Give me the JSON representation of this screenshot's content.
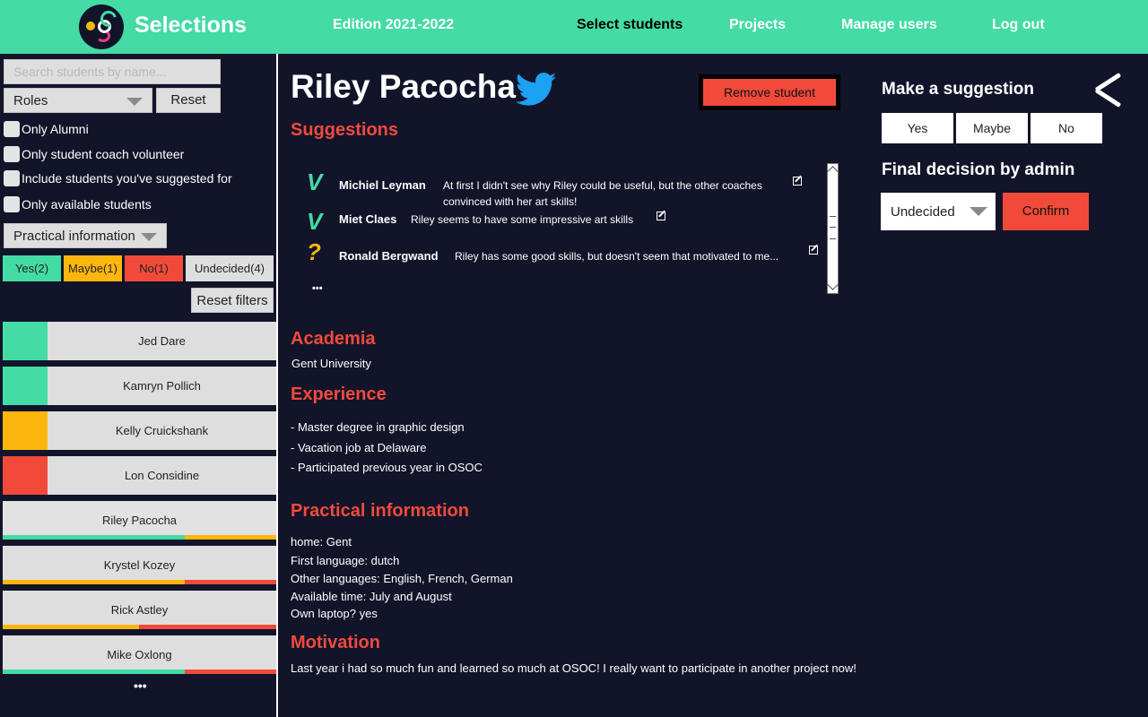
{
  "header": {
    "brand": "Selections",
    "edition": "Edition 2021-2022",
    "nav": [
      {
        "label": "Select students",
        "active": true
      },
      {
        "label": "Projects"
      },
      {
        "label": "Manage users"
      },
      {
        "label": "Log out"
      }
    ]
  },
  "sidebar": {
    "search_placeholder": "Search students by name...",
    "roles_label": "Roles",
    "reset_label": "Reset",
    "filters": [
      "Only Alumni",
      "Only student coach volunteer",
      "Include students you've suggested for",
      "Only available students"
    ],
    "practical_label": "Practical information",
    "status_buttons": [
      {
        "label": "Yes(2)",
        "color": "#44dba4"
      },
      {
        "label": "Maybe(1)",
        "color": "#fcb70f"
      },
      {
        "label": "No(1)",
        "color": "#f14a3b"
      },
      {
        "label": "Undecided(4)",
        "color": "#dedede"
      }
    ],
    "reset_filters_label": "Reset filters",
    "students": [
      {
        "name": "Jed Dare",
        "status_color": "#44dba4"
      },
      {
        "name": "Kamryn Pollich",
        "status_color": "#44dba4"
      },
      {
        "name": "Kelly Cruickshank",
        "status_color": "#fcb70f"
      },
      {
        "name": "Lon Considine",
        "status_color": "#f14a3b"
      },
      {
        "name": "Riley Pacocha",
        "bar_colors": [
          "#44dba4",
          "#44dba4",
          "#fcb70f"
        ]
      },
      {
        "name": "Krystel Kozey",
        "bar_colors": [
          "#fcb70f",
          "#fcb70f",
          "#f14a3b"
        ]
      },
      {
        "name": "Rick Astley",
        "bar_colors": [
          "#fcb70f",
          "#f14a3b"
        ]
      },
      {
        "name": "Mike Oxlong",
        "bar_colors": [
          "#44dba4",
          "#44dba4",
          "#f14a3b"
        ]
      }
    ],
    "more": "•••"
  },
  "student": {
    "name": "Riley Pacocha",
    "remove_label": "Remove student",
    "suggestions_title": "Suggestions",
    "suggestions": [
      {
        "icon": "V",
        "icon_color": "#44dba4",
        "coach": "Michiel Leyman",
        "text": "At first I didn't see why Riley could be useful, but the other coaches convinced with her art skills!"
      },
      {
        "icon": "V",
        "icon_color": "#44dba4",
        "coach": "Miet Claes",
        "text": "Riley seems to have some impressive art skills"
      },
      {
        "icon": "?",
        "icon_color": "#fcb70f",
        "coach": "Ronald Bergwand",
        "text": "Riley has some good skills, but doesn't seem that motivated to me..."
      }
    ],
    "suggestions_more": "•••",
    "academia_title": "Academia",
    "academia": "Gent University",
    "experience_title": "Experience",
    "experience": [
      "- Master degree in graphic design",
      "- Vacation job at Delaware",
      "- Participated previous year in OSOC"
    ],
    "practical_title": "Practical information",
    "practical": [
      "home: Gent",
      "First language: dutch",
      "Other languages: English, French, German",
      "Available time: July and August",
      "Own laptop? yes"
    ],
    "motivation_title": "Motivation",
    "motivation": "Last year i had so much fun and learned so much at OSOC! I really want to participate in another project now!"
  },
  "decision": {
    "suggestion_title": "Make a suggestion",
    "buttons": [
      "Yes",
      "Maybe",
      "No"
    ],
    "final_title": "Final decision by admin",
    "selected": "Undecided",
    "confirm_label": "Confirm"
  },
  "colors": {
    "accent_green": "#44dba4",
    "accent_red": "#f14a3b",
    "accent_yellow": "#fcb70f",
    "background": "#12142a"
  }
}
